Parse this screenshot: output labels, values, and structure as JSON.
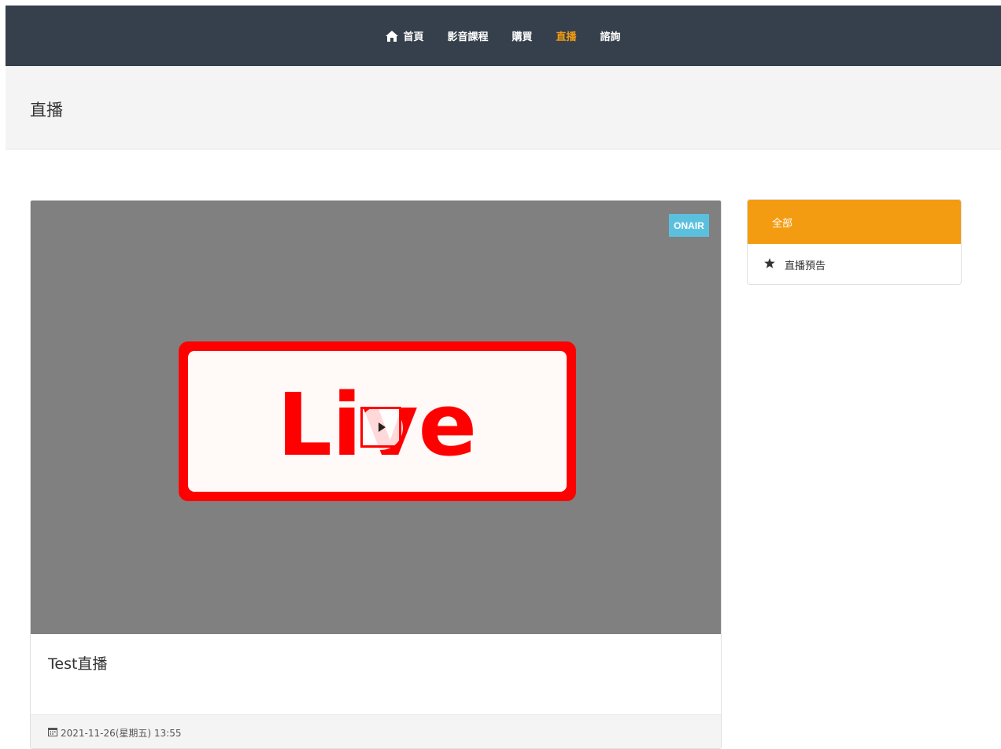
{
  "nav": {
    "items": [
      {
        "label": "首頁",
        "icon": "home-icon"
      },
      {
        "label": "影音課程"
      },
      {
        "label": "購買"
      },
      {
        "label": "直播"
      },
      {
        "label": "諮詢"
      }
    ],
    "active_color": "#f39c12",
    "background": "#36404c"
  },
  "page": {
    "title": "直播"
  },
  "card": {
    "badge": "ONAIR",
    "thumbnail_text": "Live",
    "title": "Test直播",
    "datetime": "2021-11-26(星期五) 13:55",
    "calendar_icon": "calendar-icon"
  },
  "sidebar": {
    "items": [
      {
        "label": "全部"
      },
      {
        "label": "直播預告",
        "icon": "star-icon"
      }
    ],
    "active_color": "#f39c12"
  }
}
